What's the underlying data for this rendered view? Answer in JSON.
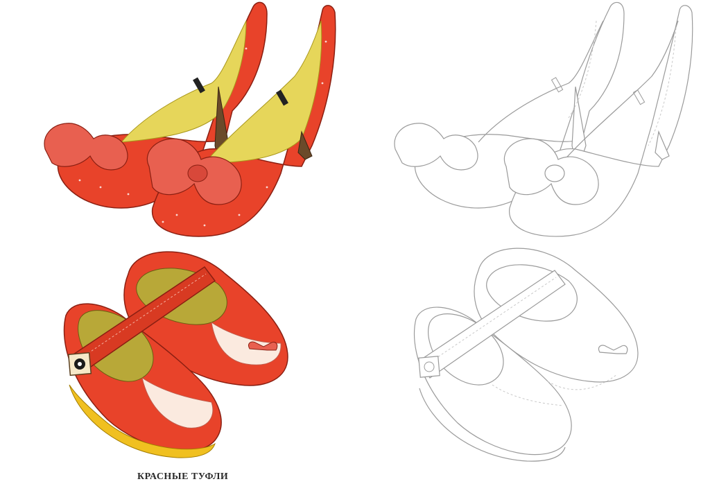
{
  "caption": "КРАСНЫЕ ТУФЛИ",
  "colors": {
    "shoe_red": "#e8432a",
    "shoe_dark_red": "#b82a1a",
    "lining_yellow": "#d8c43a",
    "lining_green": "#b8a838",
    "sole_yellow": "#f0c020",
    "outline_gray": "#9a9a9a",
    "background": "#ffffff"
  },
  "icons": {
    "heels_color": "red-high-heel-shoes-icon",
    "heels_outline": "high-heel-shoes-outline-icon",
    "kids_color": "red-mary-jane-shoes-icon",
    "kids_outline": "mary-jane-shoes-outline-icon"
  }
}
